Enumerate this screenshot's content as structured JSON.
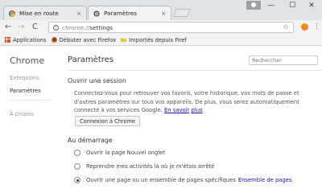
{
  "tabs": [
    {
      "label": "Mise en route",
      "close": "×",
      "active": false
    },
    {
      "label": "Paramètres",
      "close": "×",
      "active": true
    }
  ],
  "window_controls": {
    "minimize": "—",
    "maximize": "☐",
    "close": "✕"
  },
  "toolbar": {
    "back": "←",
    "forward": "→",
    "reload": "C",
    "url_prefix": "chrome://",
    "url_path": "settings",
    "bookmark_star": "☆",
    "menu": "⋮"
  },
  "bookmarks": [
    {
      "label": "Applications",
      "icon": "apps-grid-icon"
    },
    {
      "label": "Débuter avec Firefox",
      "icon": "firefox-icon"
    },
    {
      "label": "Importés depuis Firef",
      "icon": "folder-icon"
    }
  ],
  "sidebar": {
    "title": "Chrome",
    "items": [
      {
        "label": "Extensions"
      },
      {
        "label": "Paramètres"
      },
      {
        "label": "À propos"
      }
    ]
  },
  "main": {
    "title": "Paramètres",
    "search_placeholder": "Rechercher",
    "signin": {
      "heading": "Ouvrir une session",
      "text": "Connectez-vous pour retrouver vos favoris, votre historique, vos mots de passe et d'autres paramètres sur tous vos appareils. De plus, vous serez automatiquement connecté à vos services Google.",
      "link_part1": "En savoir",
      "link_part2": "plus",
      "button": "Connexion à Chrome"
    },
    "startup": {
      "heading": "Au démarrage",
      "options": [
        {
          "label": "Ouvrir la page Nouvel onglet",
          "selected": false,
          "link": ""
        },
        {
          "label": "Reprendre mes activités là où je m'étais arrêté",
          "selected": false,
          "link": ""
        },
        {
          "label": "Ouvrir une page ou un ensemble de pages spécifiques",
          "selected": true,
          "link": "Ensemble de pages"
        }
      ]
    }
  },
  "colors": {
    "accent": "#1a0dab",
    "extension": "#f08a1d",
    "tabstrip": "#dfe3e8",
    "toolbar": "#f2f2f2"
  }
}
